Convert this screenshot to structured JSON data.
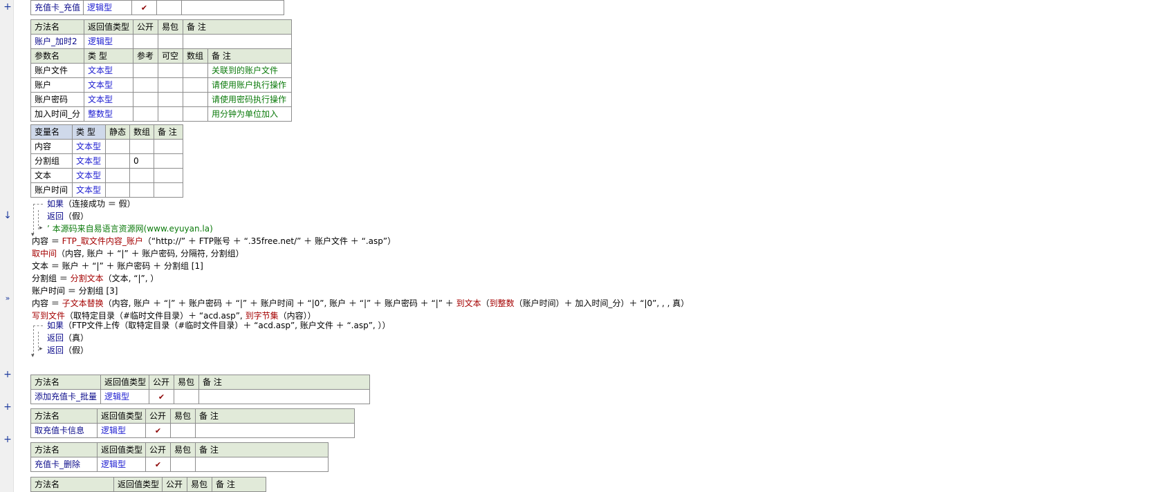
{
  "top_method": {
    "name": "充值卡_充值",
    "return_type": "逻辑型",
    "public_check": "✔"
  },
  "method_main": {
    "headers": [
      "方法名",
      "返回值类型",
      "公开",
      "易包",
      "备 注"
    ],
    "name": "账户_加时2",
    "return_type": "逻辑型",
    "param_headers": [
      "参数名",
      "类 型",
      "参考",
      "可空",
      "数组",
      "备 注"
    ],
    "params": [
      {
        "name": "账户文件",
        "type": "文本型",
        "note": "关联到的账户文件"
      },
      {
        "name": "账户",
        "type": "文本型",
        "note": "请使用账户执行操作"
      },
      {
        "name": "账户密码",
        "type": "文本型",
        "note": "请使用密码执行操作"
      },
      {
        "name": "加入时间_分",
        "type": "整数型",
        "note": "用分钟为单位加入"
      }
    ]
  },
  "variables": {
    "headers": [
      "变量名",
      "类 型",
      "静态",
      "数组",
      "备 注"
    ],
    "rows": [
      {
        "name": "内容",
        "type": "文本型",
        "array": ""
      },
      {
        "name": "分割组",
        "type": "文本型",
        "array": "0"
      },
      {
        "name": "文本",
        "type": "文本型",
        "array": ""
      },
      {
        "name": "账户时间",
        "type": "文本型",
        "array": ""
      }
    ]
  },
  "code": {
    "l1_kw": "如果",
    "l1_rest": "（连接成功 ＝ 假）",
    "l2_kw": "返回",
    "l2_rest": "（假）",
    "l3_comment": "’ 本源码来自易语言资源网(www.eyuyan.la)",
    "l4_a": "内容 ＝ ",
    "l4_fn": "FTP_取文件内容_账户",
    "l4_b": "（“http://” ＋ FTP账号 ＋ “.35free.net/” ＋ 账户文件 ＋ “.asp”）",
    "l5_fn": "取中间",
    "l5_b": "（内容, 账户 ＋ “|” ＋ 账户密码, 分隔符, 分割组）",
    "l6": "文本 ＝ 账户 ＋ “|” ＋ 账户密码 ＋ 分割组 [1]",
    "l7_a": "分割组 ＝ ",
    "l7_fn": "分割文本",
    "l7_b": "（文本, “|”, ）",
    "l8": "账户时间 ＝ 分割组 [3]",
    "l9_a": "内容 ＝ ",
    "l9_fn": "子文本替换",
    "l9_b": "（内容, 账户 ＋ “|” ＋ 账户密码 ＋ “|” ＋ 账户时间 ＋ “|0”, 账户 ＋ “|” ＋ 账户密码 ＋ “|” ＋ ",
    "l9_fn2": "到文本",
    "l9_c": "（",
    "l9_fn3": "到整数",
    "l9_d": "（账户时间）＋ 加入时间_分）＋ “|0”, , , 真）",
    "l10_fn": "写到文件",
    "l10_b": "（取特定目录（#临时文件目录）＋ “acd.asp”, ",
    "l10_fn2": "到字节集",
    "l10_c": "（内容））",
    "l11_kw": "如果",
    "l11_rest": "（FTP文件上传（取特定目录（#临时文件目录）＋ “acd.asp”, 账户文件 ＋ “.asp”, ））",
    "l12_kw": "返回",
    "l12_rest": "（真）",
    "l13_kw": "返回",
    "l13_rest": "（假）"
  },
  "methods_below": [
    {
      "headers": [
        "方法名",
        "返回值类型",
        "公开",
        "易包",
        "备 注"
      ],
      "name": "添加充值卡_批量",
      "return_type": "逻辑型",
      "public_check": "✔"
    },
    {
      "headers": [
        "方法名",
        "返回值类型",
        "公开",
        "易包",
        "备 注"
      ],
      "name": "取充值卡信息",
      "return_type": "逻辑型",
      "public_check": "✔"
    },
    {
      "headers": [
        "方法名",
        "返回值类型",
        "公开",
        "易包",
        "备 注"
      ],
      "name": "充值卡_删除",
      "return_type": "逻辑型",
      "public_check": "✔"
    },
    {
      "headers": [
        "方法名",
        "返回值类型",
        "公开",
        "易包",
        "备 注"
      ]
    }
  ],
  "gutter": {
    "expand": "+",
    "down_arrow": "↓",
    "run_arrow": "»"
  }
}
